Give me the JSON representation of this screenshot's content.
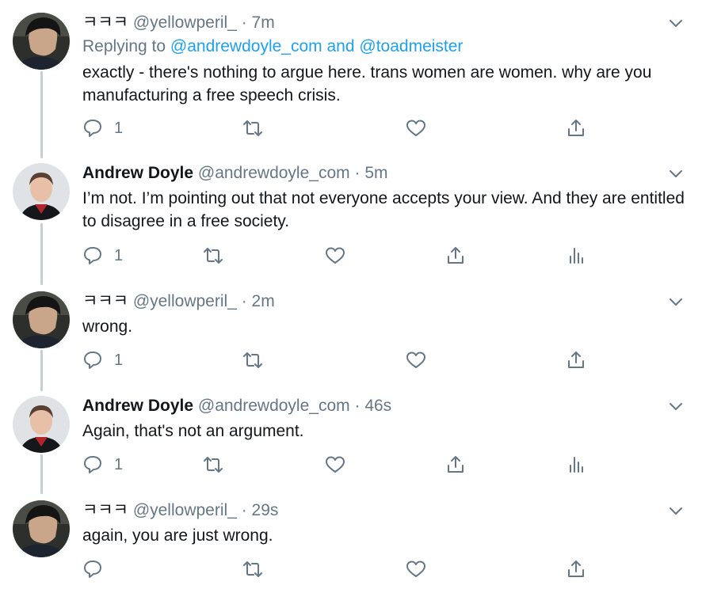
{
  "tweets": [
    {
      "name": "ㅋㅋㅋ",
      "handle": "@yellowperil_",
      "dot": "·",
      "time": "7m",
      "reply_prefix": "Replying to",
      "reply_user1": "@andrewdoyle_com",
      "reply_and": "and",
      "reply_user2": "@toadmeister",
      "text": "exactly - there's nothing to argue here. trans women are women. why are you manufacturing a free speech crisis.",
      "reply_count": "1"
    },
    {
      "name": "Andrew Doyle",
      "handle": "@andrewdoyle_com",
      "dot": "·",
      "time": "5m",
      "text": "I’m not. I’m pointing out that not everyone accepts your view. And they are entitled to disagree in a free society.",
      "reply_count": "1"
    },
    {
      "name": "ㅋㅋㅋ",
      "handle": "@yellowperil_",
      "dot": "·",
      "time": "2m",
      "text": "wrong.",
      "reply_count": "1"
    },
    {
      "name": "Andrew Doyle",
      "handle": "@andrewdoyle_com",
      "dot": "·",
      "time": "46s",
      "text": "Again, that's not an argument.",
      "reply_count": "1"
    },
    {
      "name": "ㅋㅋㅋ",
      "handle": "@yellowperil_",
      "dot": "·",
      "time": "29s",
      "text": "again, you are just wrong.",
      "reply_count": ""
    }
  ],
  "icons": {
    "reply": "reply-icon",
    "retweet": "retweet-icon",
    "like": "heart-icon",
    "share": "share-icon",
    "analytics": "analytics-icon",
    "more": "chevron-down-icon"
  },
  "colors": {
    "secondary_text": "#657786",
    "link": "#1da1f2",
    "thread_line": "#c4cfd6"
  }
}
